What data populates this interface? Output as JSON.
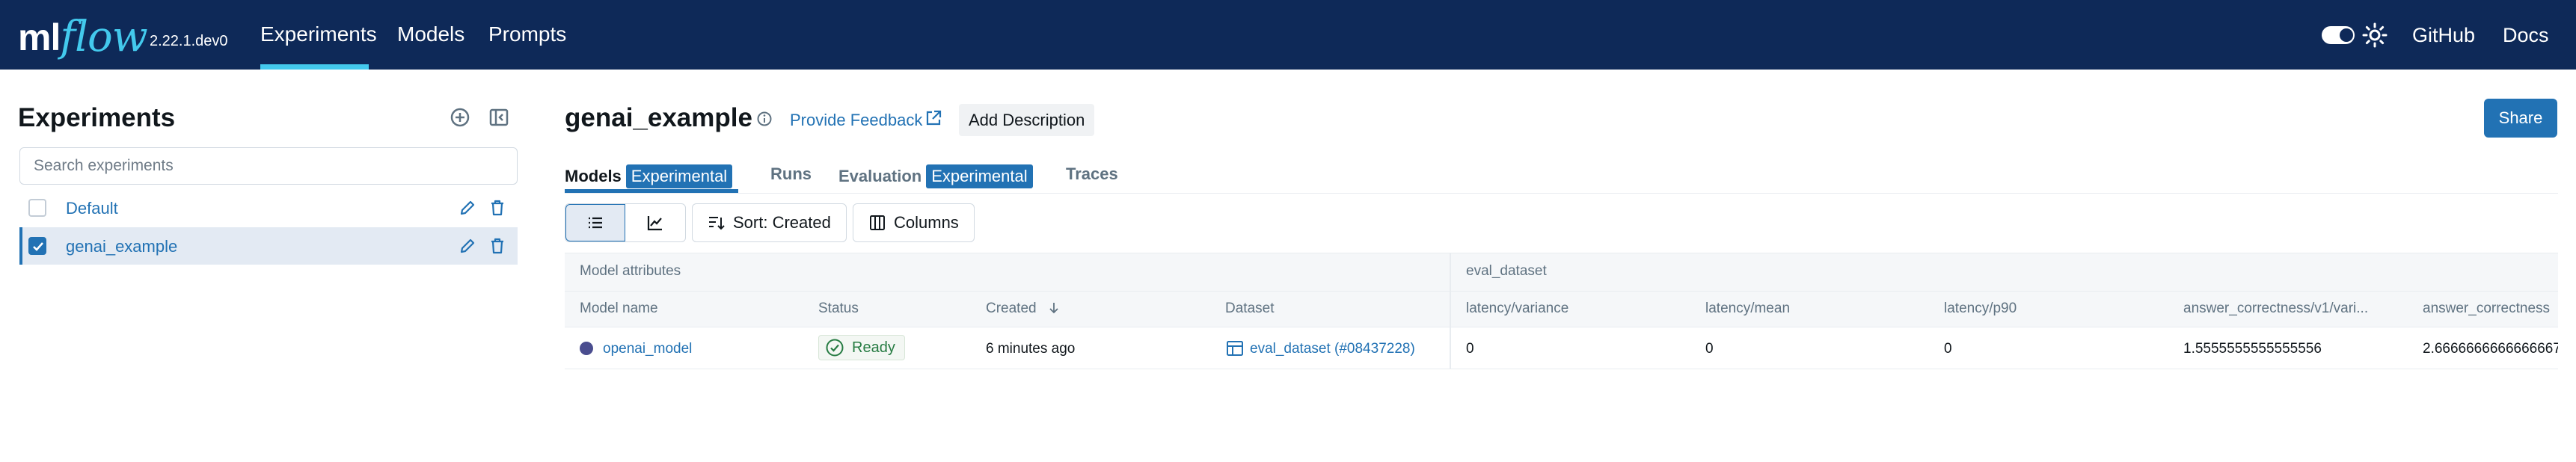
{
  "nav": {
    "logo_ml": "ml",
    "logo_flow": "flow",
    "version": "2.22.1.dev0",
    "items": [
      {
        "label": "Experiments",
        "active": true
      },
      {
        "label": "Models"
      },
      {
        "label": "Prompts"
      }
    ],
    "github": "GitHub",
    "docs": "Docs"
  },
  "sidebar": {
    "title": "Experiments",
    "search_placeholder": "Search experiments",
    "experiments": [
      {
        "label": "Default",
        "checked": false
      },
      {
        "label": "genai_example",
        "checked": true
      }
    ]
  },
  "header": {
    "title": "genai_example",
    "feedback": "Provide Feedback",
    "add_description": "Add Description",
    "share": "Share"
  },
  "tabs": [
    {
      "label": "Models",
      "badge": "Experimental",
      "active": true
    },
    {
      "label": "Runs"
    },
    {
      "label": "Evaluation",
      "badge": "Experimental"
    },
    {
      "label": "Traces"
    }
  ],
  "toolbar": {
    "sort": "Sort: Created",
    "columns": "Columns"
  },
  "table": {
    "groups": [
      "Model attributes",
      "eval_dataset"
    ],
    "columns": [
      "Model name",
      "Status",
      "Created",
      "Dataset",
      "latency/variance",
      "latency/mean",
      "latency/p90",
      "answer_correctness/v1/vari...",
      "answer_correctness"
    ],
    "rows": [
      {
        "model_name": "openai_model",
        "status": "Ready",
        "created": "6 minutes ago",
        "dataset": "eval_dataset (#08437228)",
        "latency_variance": "0",
        "latency_mean": "0",
        "latency_p90": "0",
        "answer_correctness_variance": "1.5555555555555556",
        "answer_correctness": "2.6666666666666667"
      }
    ]
  },
  "colors": {
    "nav_bg": "#0e2958",
    "accent": "#2272b4",
    "logo_flow": "#43c9ed",
    "status_ready": "#277c43"
  }
}
